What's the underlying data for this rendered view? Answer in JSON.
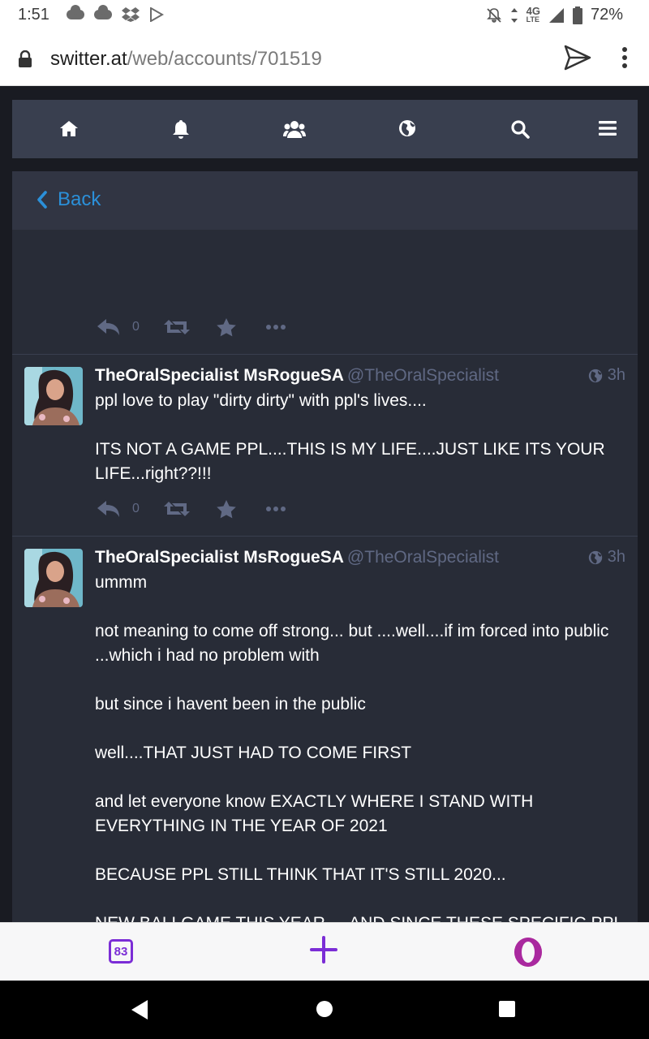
{
  "statusbar": {
    "time": "1:51",
    "network": "4G",
    "network_sub": "LTE",
    "battery": "72%",
    "icons": [
      "cloud-icon",
      "cloud-icon",
      "dropbox-icon",
      "play-store-icon",
      "mute-icon",
      "data-arrows-icon",
      "signal-icon",
      "battery-icon"
    ]
  },
  "browser": {
    "url_host": "switter.at",
    "url_path": "/web/accounts/701519"
  },
  "nav": {
    "items": [
      "home-icon",
      "notifications-bell-icon",
      "local-timeline-people-icon",
      "federated-globe-icon",
      "search-icon",
      "menu-icon"
    ]
  },
  "column": {
    "back_label": "Back"
  },
  "statuses": [
    {
      "display_name": "TheOralSpecialist MsRogueSA",
      "acct": "@TheOralSpecialist",
      "time": "3h",
      "paragraphs": [
        "ppl love to play \"dirty dirty\" with ppl's lives....",
        "ITS NOT A GAME PPL....THIS IS MY LIFE....JUST LIKE ITS YOUR LIFE...right??!!!"
      ],
      "reply_count": "0"
    },
    {
      "display_name": "TheOralSpecialist MsRogueSA",
      "acct": "@TheOralSpecialist",
      "time": "3h",
      "paragraphs": [
        "ummm",
        "not meaning to come off strong... but ....well....if im forced into public ...which i had no problem with",
        "but since i havent been in the public",
        "well....THAT JUST HAD TO COME FIRST",
        "and let everyone know EXACTLY WHERE I STAND WITH EVERYTHING IN THE YEAR OF 2021",
        "BECAUSE PPL STILL THINK THAT IT'S STILL 2020...",
        "NEW BALLGAME THIS YEAR,....AND SINCE THESE SPECIFIC PPL HAVE BEEN DICTACTING MY LIFE...ILL GUESS WE WILL JUST SEE HUH"
      ],
      "reply_count": "0"
    }
  ],
  "top_actions": {
    "reply_count": "0"
  },
  "operabar": {
    "tabs_count": "83"
  },
  "colors": {
    "accent": "#2b90d9",
    "bg": "#282c37",
    "muted": "#606984",
    "opera": "#7b2dd6"
  }
}
